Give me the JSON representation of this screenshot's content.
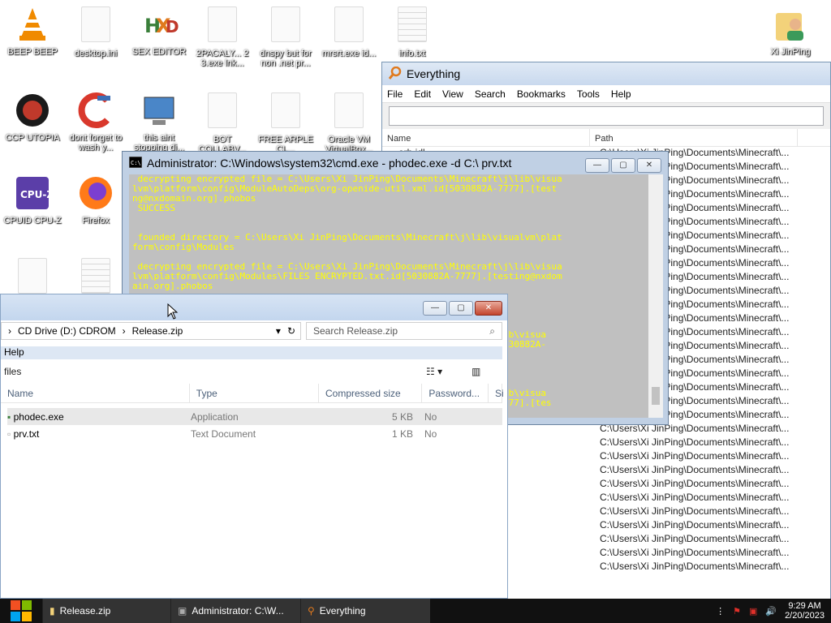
{
  "desktop": {
    "icons": [
      {
        "label": "BEEP BEEP"
      },
      {
        "label": "desktop.ini"
      },
      {
        "label": "SEX EDITOR"
      },
      {
        "label": "2PACALY... 2 3.exe lnk..."
      },
      {
        "label": "dnspy but for non .net pr..."
      },
      {
        "label": "mrsrt.exe id..."
      },
      {
        "label": "info.txt"
      },
      {
        "label": "Xi JinPing"
      },
      {
        "label": "CCP UTOPIA"
      },
      {
        "label": "dont forget to wash y..."
      },
      {
        "label": "this aint stopping di..."
      },
      {
        "label": "BOT COLLABV..."
      },
      {
        "label": "FREE ARPLE CL..."
      },
      {
        "label": "Oracle VM VirtualBox..."
      },
      {
        "label": "CPUID CPU-Z"
      },
      {
        "label": "Firefox"
      }
    ]
  },
  "everything": {
    "title": "Everything",
    "menu": [
      "File",
      "Edit",
      "View",
      "Search",
      "Bookmarks",
      "Tools",
      "Help"
    ],
    "search_value": "",
    "columns": [
      "Name",
      "Path"
    ],
    "first_row_name": "orb.idl",
    "path_value": "C:\\Users\\Xi JinPing\\Documents\\Minecraft\\...",
    "row_count": 31
  },
  "cmd": {
    "title": "Administrator: C:\\Windows\\system32\\cmd.exe - phodec.exe  -d C:\\ prv.txt",
    "lines": [
      " decrypting encrypted file = C:\\Users\\Xi JinPing\\Documents\\Minecraft\\j\\lib\\visua",
      "lvm\\platform\\config\\ModuleAutoDeps\\org-openide-util.xml.id[5030882A-7777].[test",
      "ng@nxdomain.org].phobos",
      " SUCCESS",
      "",
      "",
      " founded directory = C:\\Users\\Xi JinPing\\Documents\\Minecraft\\j\\lib\\visualvm\\plat",
      "form\\config\\Modules",
      "",
      " decrypting encrypted file = C:\\Users\\Xi JinPing\\Documents\\Minecraft\\j\\lib\\visua",
      "lvm\\platform\\config\\Modules\\FILES ENCRYPTED.txt.id[5030882A-7777].[testing@nxdom",
      "ain.org].phobos",
      "",
      "",
      "",
      "",
      "                                                        Minecraft\\j\\lib\\visua",
      "                                                        mmon.xml.id[5030882A-",
      "",
      "",
      "",
      "",
      "                                                        Minecraft\\j\\lib\\visua",
      "                                                        id[5030882A-7777].[tes"
    ]
  },
  "explorer": {
    "breadcrumb": [
      "CD Drive (D:) CDROM",
      "Release.zip"
    ],
    "search_placeholder": "Search Release.zip",
    "menu_help": "Help",
    "toolbar_label": "files",
    "columns": [
      "Name",
      "Type",
      "Compressed size",
      "Password...",
      "Si"
    ],
    "files": [
      {
        "name": "phodec.exe",
        "type": "Application",
        "size": "5 KB",
        "password": "No"
      },
      {
        "name": "prv.txt",
        "type": "Text Document",
        "size": "1 KB",
        "password": "No"
      }
    ]
  },
  "taskbar": {
    "items": [
      {
        "label": "Release.zip",
        "icon": "folder-icon"
      },
      {
        "label": "Administrator: C:\\W...",
        "icon": "cmd-icon"
      },
      {
        "label": "Everything",
        "icon": "search-icon"
      }
    ],
    "time": "9:29 AM",
    "date": "2/20/2023"
  }
}
